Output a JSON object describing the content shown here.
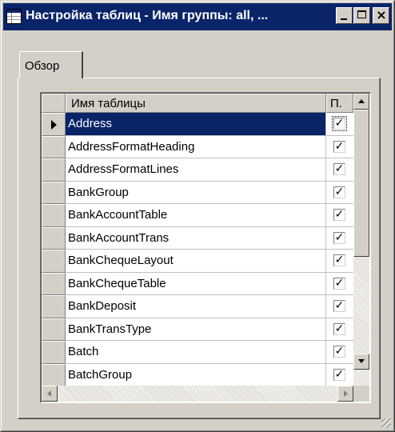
{
  "window": {
    "title": "Настройка таблиц - Имя группы: all, ...",
    "minimize_label": "",
    "maximize_label": "",
    "close_label": "×"
  },
  "tabs": [
    {
      "label": "Обзор",
      "active": true
    }
  ],
  "grid": {
    "columns": [
      {
        "label": ""
      },
      {
        "label": "Имя таблицы"
      },
      {
        "label": "П."
      }
    ],
    "rows": [
      {
        "name": "Address",
        "checked": "✓",
        "selected": true
      },
      {
        "name": "AddressFormatHeading",
        "checked": "✓",
        "selected": false
      },
      {
        "name": "AddressFormatLines",
        "checked": "✓",
        "selected": false
      },
      {
        "name": "BankGroup",
        "checked": "✓",
        "selected": false
      },
      {
        "name": "BankAccountTable",
        "checked": "✓",
        "selected": false
      },
      {
        "name": "BankAccountTrans",
        "checked": "✓",
        "selected": false
      },
      {
        "name": "BankChequeLayout",
        "checked": "✓",
        "selected": false
      },
      {
        "name": "BankChequeTable",
        "checked": "✓",
        "selected": false
      },
      {
        "name": "BankDeposit",
        "checked": "✓",
        "selected": false
      },
      {
        "name": "BankTransType",
        "checked": "✓",
        "selected": false
      },
      {
        "name": "Batch",
        "checked": "✓",
        "selected": false
      },
      {
        "name": "BatchGroup",
        "checked": "✓",
        "selected": false
      }
    ]
  },
  "colors": {
    "titlebar": "#0a246a",
    "face": "#d4d0c8",
    "selection": "#0a246a"
  },
  "icons": {
    "window": "table-icon",
    "row_pointer": "arrow-right-icon",
    "checkbox": "checkmark-icon"
  }
}
